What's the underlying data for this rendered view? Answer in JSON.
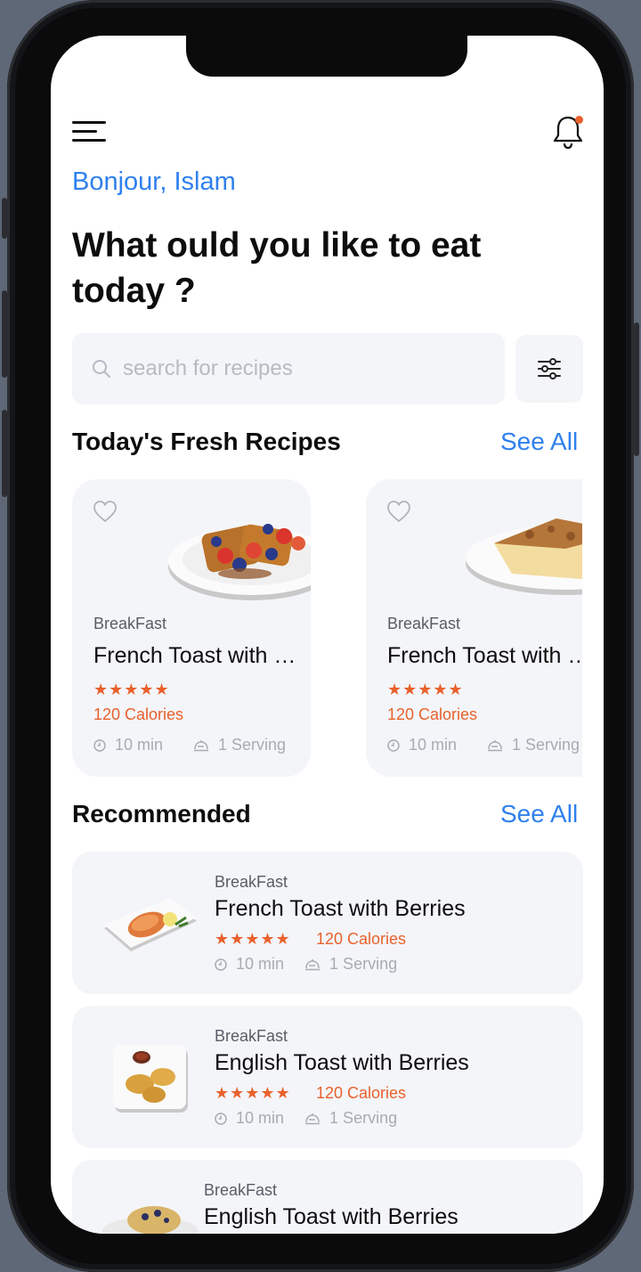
{
  "header": {
    "greeting": "Bonjour, Islam",
    "headline": "What ould you like to eat today ?"
  },
  "search": {
    "placeholder": "search for recipes"
  },
  "fresh_section": {
    "title": "Today's Fresh Recipes",
    "see_all": "See All",
    "cards": [
      {
        "category": "BreakFast",
        "title": "French Toast with Berries",
        "rating": "★★★★★",
        "calories": "120 Calories",
        "time": "10 min",
        "servings": "1 Serving"
      },
      {
        "category": "BreakFast",
        "title": "French Toast with Berries",
        "rating": "★★★★★",
        "calories": "120 Calories",
        "time": "10 min",
        "servings": "1 Serving"
      }
    ]
  },
  "recommended_section": {
    "title": "Recommended",
    "see_all": "See All",
    "items": [
      {
        "category": "BreakFast",
        "title": "French Toast with Berries",
        "rating": "★★★★★",
        "calories": "120 Calories",
        "time": "10 min",
        "servings": "1 Serving"
      },
      {
        "category": "BreakFast",
        "title": "English Toast with Berries",
        "rating": "★★★★★",
        "calories": "120 Calories",
        "time": "10 min",
        "servings": "1 Serving"
      },
      {
        "category": "BreakFast",
        "title": "English Toast with Berries"
      }
    ]
  },
  "colors": {
    "accent": "#2f80ed",
    "rating": "#e8612c",
    "card_background": "#f4f5f9"
  }
}
